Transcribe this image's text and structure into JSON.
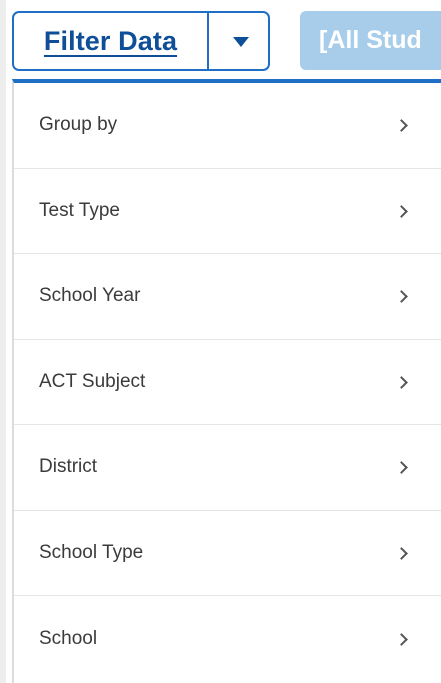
{
  "toolbar": {
    "filter_label": "Filter Data",
    "student_filter_label": "[All Stud"
  },
  "menu": {
    "items": [
      {
        "label": "Group by"
      },
      {
        "label": "Test Type"
      },
      {
        "label": "School Year"
      },
      {
        "label": "ACT Subject"
      },
      {
        "label": "District"
      },
      {
        "label": "School Type"
      },
      {
        "label": "School"
      }
    ]
  },
  "colors": {
    "accent": "#1f6fc6",
    "accent_dark": "#0f4f98",
    "button_light": "#a7cdea",
    "text": "#3b3b3b",
    "divider": "#e5e5e5"
  },
  "icons": {
    "dropdown_toggle": "caret-down-icon",
    "menu_item": "chevron-right-icon"
  }
}
